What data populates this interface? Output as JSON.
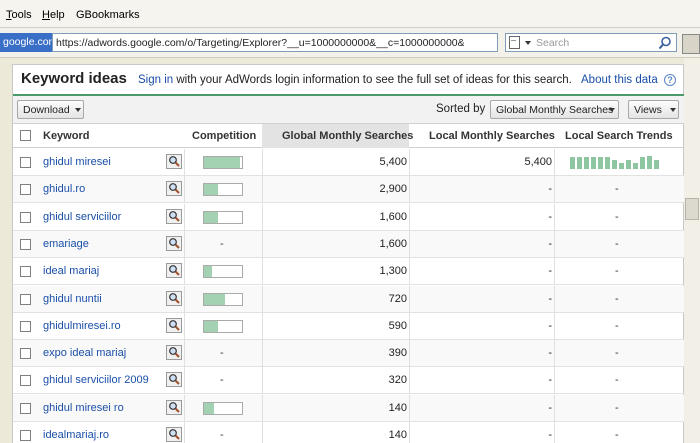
{
  "browser": {
    "menu": [
      {
        "label": "Tools",
        "underline": "T",
        "rest": "ools"
      },
      {
        "label": "Help",
        "underline": "H",
        "rest": "elp"
      },
      {
        "label": "GBookmarks",
        "underline": "",
        "rest": "GBookmarks"
      }
    ],
    "site_badge": "google.com",
    "url": "https://adwords.google.com/o/Targeting/Explorer?__u=1000000000&__c=1000000000&styleF",
    "search_placeholder": "Search"
  },
  "panel": {
    "title": "Keyword ideas",
    "signin_link": "Sign in",
    "signin_rest": " with your AdWords login information to see the full set of ideas for this search.",
    "about_link": "About this data",
    "help": "?"
  },
  "controls": {
    "download": "Download",
    "sorted_by_label": "Sorted by",
    "sort_value": "Global Monthly Searches",
    "views": "Views"
  },
  "table": {
    "columns": {
      "keyword": "Keyword",
      "competition": "Competition",
      "global": "Global Monthly Searches",
      "local": "Local Monthly Searches",
      "trends": "Local Search Trends"
    },
    "rows": [
      {
        "keyword": "ghidul miresei",
        "competition": 0.95,
        "competition_text": "",
        "global": "5,400",
        "local": "5,400",
        "trend": [
          0.9,
          0.9,
          0.9,
          0.9,
          0.9,
          0.9,
          0.7,
          0.5,
          0.7,
          0.5,
          0.9,
          1.0,
          0.7
        ]
      },
      {
        "keyword": "ghidul.ro",
        "competition": 0.38,
        "competition_text": "",
        "global": "2,900",
        "local": "-",
        "trend_text": "-"
      },
      {
        "keyword": "ghidul serviciilor",
        "competition": 0.38,
        "competition_text": "",
        "global": "1,600",
        "local": "-",
        "trend_text": "-"
      },
      {
        "keyword": "emariage",
        "competition": null,
        "competition_text": "-",
        "global": "1,600",
        "local": "-",
        "trend_text": "-"
      },
      {
        "keyword": "ideal mariaj",
        "competition": 0.2,
        "competition_text": "",
        "global": "1,300",
        "local": "-",
        "trend_text": "-"
      },
      {
        "keyword": "ghidul nuntii",
        "competition": 0.55,
        "competition_text": "",
        "global": "720",
        "local": "-",
        "trend_text": "-"
      },
      {
        "keyword": "ghidulmiresei.ro",
        "competition": 0.38,
        "competition_text": "",
        "global": "590",
        "local": "-",
        "trend_text": "-"
      },
      {
        "keyword": "expo ideal mariaj",
        "competition": null,
        "competition_text": "-",
        "global": "390",
        "local": "-",
        "trend_text": "-"
      },
      {
        "keyword": "ghidul serviciilor 2009",
        "competition": null,
        "competition_text": "-",
        "global": "320",
        "local": "-",
        "trend_text": "-"
      },
      {
        "keyword": "ghidul miresei ro",
        "competition": 0.25,
        "competition_text": "",
        "global": "140",
        "local": "-",
        "trend_text": "-"
      },
      {
        "keyword": "idealmariaj.ro",
        "competition": null,
        "competition_text": "-",
        "global": "140",
        "local": "-",
        "trend_text": "-"
      }
    ]
  },
  "colors": {
    "accent_green": "#4a9a6a",
    "bar_green": "#a3d2b3",
    "link_blue": "#1a4fa8"
  }
}
